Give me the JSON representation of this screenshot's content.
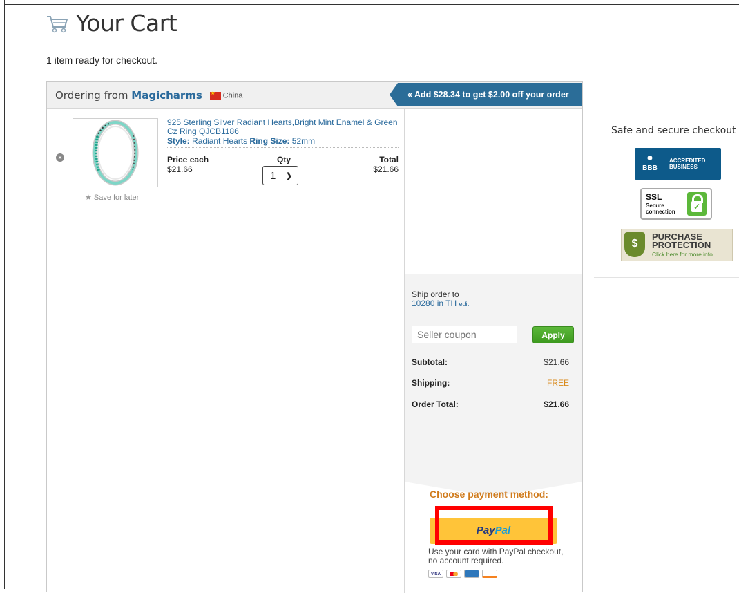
{
  "page": {
    "title": "Your Cart",
    "ready_text": "1 item ready for checkout."
  },
  "order": {
    "from_prefix": "Ordering from",
    "seller": "Magicharms",
    "country": "China",
    "promo": "« Add $28.34 to get $2.00 off your order"
  },
  "item": {
    "name": "925 Sterling Silver Radiant Hearts,Bright Mint Enamel & Green Cz Ring QJCB1186",
    "style_label": "Style:",
    "style_value": "Radiant Hearts",
    "size_label": "Ring Size:",
    "size_value": "52mm",
    "price_label": "Price each",
    "price": "$21.66",
    "qty_label": "Qty",
    "qty_value": "1",
    "total_label": "Total",
    "total": "$21.66",
    "save_later": "Save for later"
  },
  "summary": {
    "ship_to_label": "Ship order to",
    "ship_to_value": "10280 in TH",
    "edit_label": "edit",
    "coupon_placeholder": "Seller coupon",
    "apply_label": "Apply",
    "subtotal_label": "Subtotal:",
    "subtotal": "$21.66",
    "shipping_label": "Shipping:",
    "shipping": "FREE",
    "order_total_label": "Order Total:",
    "order_total": "$21.66"
  },
  "payment": {
    "title": "Choose payment method:",
    "paypal_pay": "Pay",
    "paypal_pal": "Pal",
    "note": "Use your card with PayPal checkout, no account required.",
    "cards": [
      "VISA",
      "MC",
      "AMEX",
      "DISCOVER"
    ]
  },
  "secure": {
    "heading": "Safe and secure checkout",
    "bbb_logo": "BBB",
    "bbb_line1": "ACCREDITED",
    "bbb_line2": "BUSINESS",
    "ssl_title": "SSL",
    "ssl_line1": "Secure",
    "ssl_line2": "connection",
    "pp_line1": "PURCHASE",
    "pp_line2": "PROTECTION",
    "pp_sub": "Click here for more info"
  },
  "colors": {
    "accent": "#2a6a9c",
    "promo_bg": "#2b6d98",
    "apply_green": "#4aa52a",
    "paypal_yellow": "#ffc439",
    "highlight": "#ff0000",
    "free_orange": "#d98a1b"
  }
}
